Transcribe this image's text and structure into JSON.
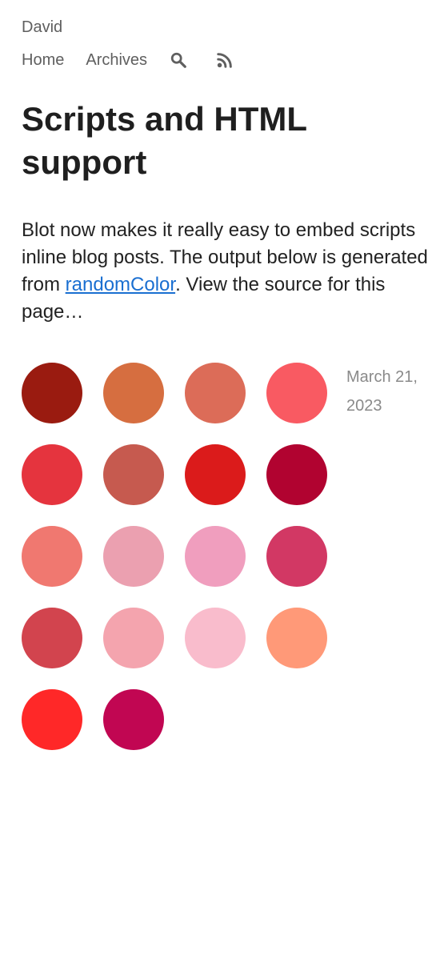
{
  "site": {
    "name": "David"
  },
  "nav": {
    "home": "Home",
    "archives": "Archives",
    "search_icon": "search-icon",
    "rss_icon": "rss-icon"
  },
  "post": {
    "title": "Scripts and HTML support",
    "intro_before": "Blot now makes it really easy to embed scripts inline blog posts. The output below is generated from ",
    "link_text": "randomColor",
    "intro_after": ". View the source for this page…",
    "date": "March 21, 2023"
  },
  "colors": {
    "text": "#222222",
    "muted": "#5f5f5f",
    "date": "#8a8a8a",
    "link": "#1a6fd1"
  },
  "swatches": [
    "#9a1b10",
    "#d66e40",
    "#dc6c58",
    "#f95a62",
    "#e5343e",
    "#c65a4f",
    "#db1b1b",
    "#b10330",
    "#f07870",
    "#eba0b0",
    "#f09ebe",
    "#d23864",
    "#d2444e",
    "#f4a4ae",
    "#f9bccc",
    "#ff9978",
    "#ff2828",
    "#c10652"
  ]
}
